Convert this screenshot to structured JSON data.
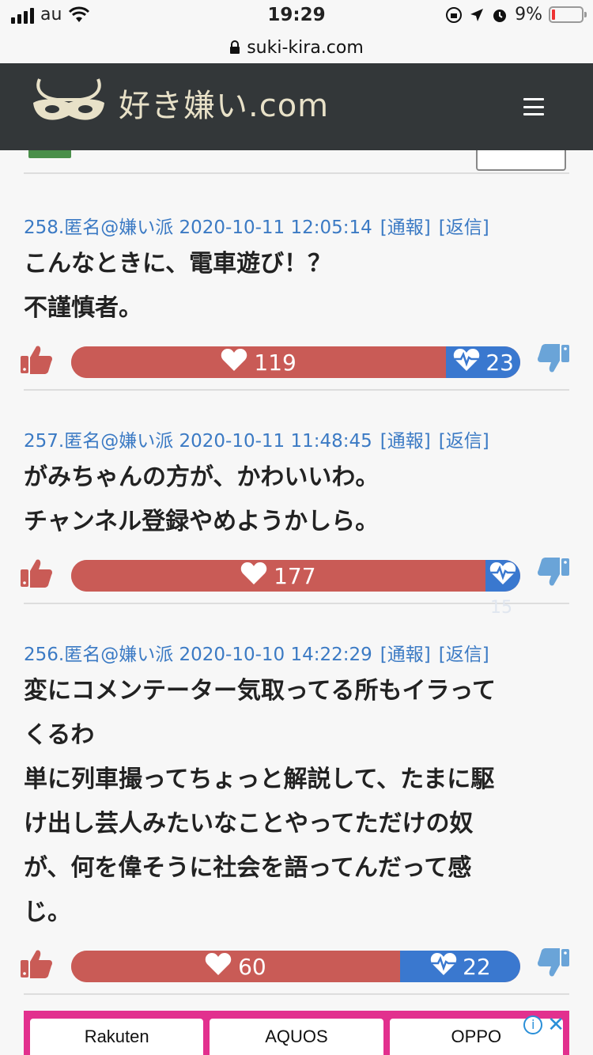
{
  "status_bar": {
    "carrier": "au",
    "time": "19:29",
    "battery": "9%"
  },
  "url_bar": {
    "url": "suki-kira.com"
  },
  "header": {
    "site_name": "好き嫌い.com"
  },
  "comments": [
    {
      "meta": "258.匿名@嫌い派 2020-10-11 12:05:14",
      "report": "[通報]",
      "reply": "[返信]",
      "body": "こんなときに、電車遊び！？\n不謹慎者。",
      "likes": "119",
      "dislikes": "23",
      "like_fraction": 0.835
    },
    {
      "meta": "257.匿名@嫌い派 2020-10-11 11:48:45",
      "report": "[通報]",
      "reply": "[返信]",
      "body": "がみちゃんの方が、かわいいわ。\nチャンネル登録やめようかしら。",
      "likes": "177",
      "dislikes": "15",
      "like_fraction": 0.922
    },
    {
      "meta": "256.匿名@嫌い派 2020-10-10 14:22:29",
      "report": "[通報]",
      "reply": "[返信]",
      "body": "変にコメンテーター気取ってる所もイラって\nくるわ\n単に列車撮ってちょっと解説して、たまに駆\nけ出し芸人みたいなことやってただけの奴\nが、何を偉そうに社会を語ってんだって感\nじ。",
      "likes": "60",
      "dislikes": "22",
      "like_fraction": 0.732
    }
  ],
  "bottom_ad": {
    "cards": [
      "Rakuten",
      "AQUOS",
      "OPPO"
    ],
    "info_icon": "i",
    "close_icon": "✕"
  },
  "colors": {
    "header_bg": "#333739",
    "like_red": "#c95b56",
    "dislike_blue": "#3a78cf",
    "meta_blue": "#3b7ac4",
    "ad_pink": "#e2308e"
  }
}
